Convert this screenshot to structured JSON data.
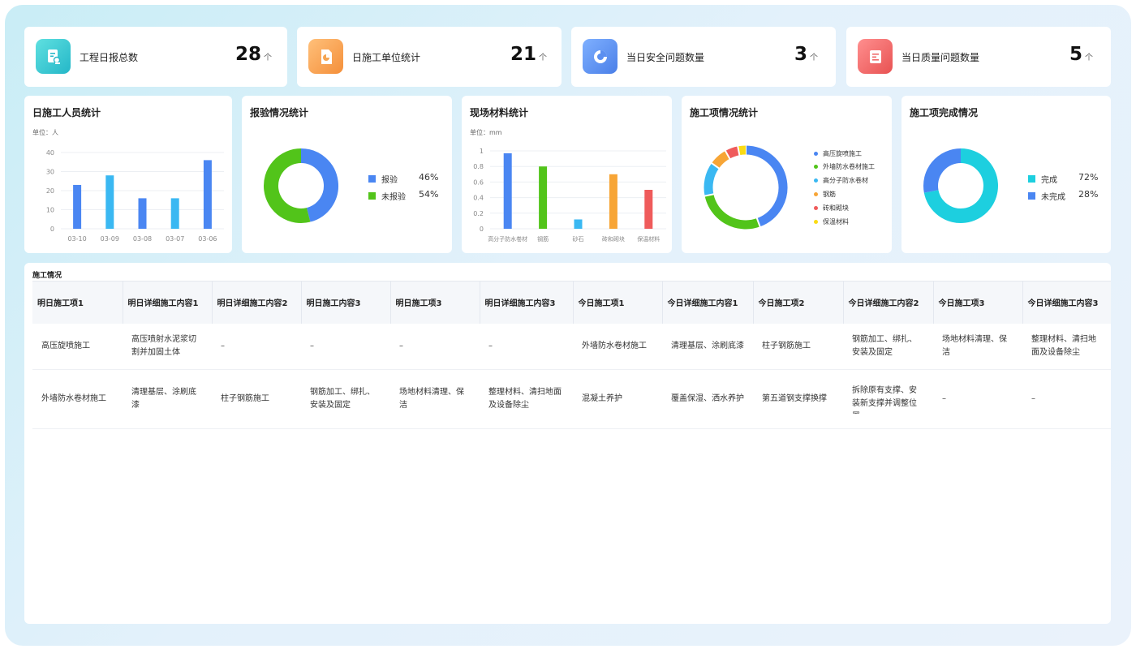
{
  "stats": [
    {
      "label": "工程日报总数",
      "value": "28",
      "unit": "个",
      "icon": "report-doc-icon",
      "color": "#3fc9cf"
    },
    {
      "label": "日施工单位统计",
      "value": "21",
      "unit": "个",
      "icon": "doc-pie-icon",
      "color": "#f5a552"
    },
    {
      "label": "当日安全问题数量",
      "value": "3",
      "unit": "个",
      "icon": "pie-chart-icon",
      "color": "#5b8ff0"
    },
    {
      "label": "当日质量问题数量",
      "value": "5",
      "unit": "个",
      "icon": "doc-list-icon",
      "color": "#ef6a6a"
    }
  ],
  "panels": {
    "workers": {
      "title": "日施工人员统计",
      "unit": "单位：人"
    },
    "inspection": {
      "title": "报验情况统计"
    },
    "materials": {
      "title": "现场材料统计",
      "unit": "单位：mm"
    },
    "items": {
      "title": "施工项情况统计"
    },
    "completion": {
      "title": "施工项完成情况"
    }
  },
  "chart_data": [
    {
      "type": "bar",
      "title": "日施工人员统计",
      "ylabel": "单位：人",
      "categories": [
        "03-10",
        "03-09",
        "03-08",
        "03-07",
        "03-06"
      ],
      "values": [
        23,
        28,
        16,
        16,
        36
      ],
      "ylim": [
        0,
        40
      ],
      "yticks": [
        0,
        10,
        20,
        30,
        40
      ],
      "colors": [
        "#4a86f2",
        "#3ab8f2",
        "#4a86f2",
        "#3ab8f2",
        "#4a86f2"
      ],
      "grid": true
    },
    {
      "type": "pie",
      "title": "报验情况统计",
      "labels": [
        "报验",
        "未报验"
      ],
      "values": [
        46,
        54
      ],
      "display": [
        "46%",
        "54%"
      ],
      "colors": [
        "#4a86f2",
        "#52c41a"
      ],
      "legend": "right"
    },
    {
      "type": "bar",
      "title": "现场材料统计",
      "ylabel": "单位：mm",
      "categories": [
        "高分子防水卷材",
        "钢筋",
        "砂石",
        "砖和砌块",
        "保温材料"
      ],
      "values": [
        0.97,
        0.8,
        0.12,
        0.7,
        0.5
      ],
      "ylim": [
        0,
        1
      ],
      "yticks": [
        0,
        0.2,
        0.4,
        0.6,
        0.8,
        1
      ],
      "ytick_labels": [
        "0",
        "0.2",
        "0.4",
        "0.6",
        "0.8",
        "1"
      ],
      "colors": [
        "#4a86f2",
        "#52c41a",
        "#3ab8f2",
        "#f7a536",
        "#ef5b5b"
      ],
      "grid": true
    },
    {
      "type": "pie",
      "title": "施工项情况统计",
      "labels": [
        "高压旋喷施工",
        "外墙防水卷材施工",
        "高分子防水卷材",
        "钢筋",
        "砖和砌块",
        "保温材料"
      ],
      "values": [
        44,
        27,
        13,
        7,
        5,
        3
      ],
      "colors": [
        "#4a86f2",
        "#52c41a",
        "#3ab8f2",
        "#f7a536",
        "#ef5b5b",
        "#fadb14"
      ],
      "legend": "right"
    },
    {
      "type": "pie",
      "title": "施工项完成情况",
      "labels": [
        "完成",
        "未完成"
      ],
      "values": [
        72,
        28
      ],
      "display": [
        "72%",
        "28%"
      ],
      "colors": [
        "#1dcfdf",
        "#4a86f2"
      ],
      "legend": "right"
    }
  ],
  "table": {
    "section_title": "施工情况",
    "headers": [
      "明日施工项1",
      "明日详细施工内容1",
      "明日详细施工内容2",
      "明日施工内容3",
      "明日施工项3",
      "明日详细施工内容3",
      "今日施工项1",
      "今日详细施工内容1",
      "今日施工项2",
      "今日详细施工内容2",
      "今日施工项3",
      "今日详细施工内容3"
    ],
    "rows": [
      [
        "高压旋喷施工",
        "高压喷射水泥浆切割并加固土体",
        "–",
        "–",
        "–",
        "–",
        "外墙防水卷材施工",
        "清理基层、涂刷底漆",
        "柱子钢筋施工",
        "钢筋加工、绑扎、安装及固定",
        "场地材料清理、保洁",
        "整理材料、清扫地面及设备除尘"
      ],
      [
        "外墙防水卷材施工",
        "清理基层、涂刷底漆",
        "柱子钢筋施工",
        "钢筋加工、绑扎、安装及固定",
        "场地材料清理、保洁",
        "整理材料、清扫地面及设备除尘",
        "混凝土养护",
        "覆盖保湿、洒水养护",
        "第五道钢支撑换撑",
        "拆除原有支撑、安装新支撑并调整位置",
        "–",
        "–"
      ]
    ]
  }
}
